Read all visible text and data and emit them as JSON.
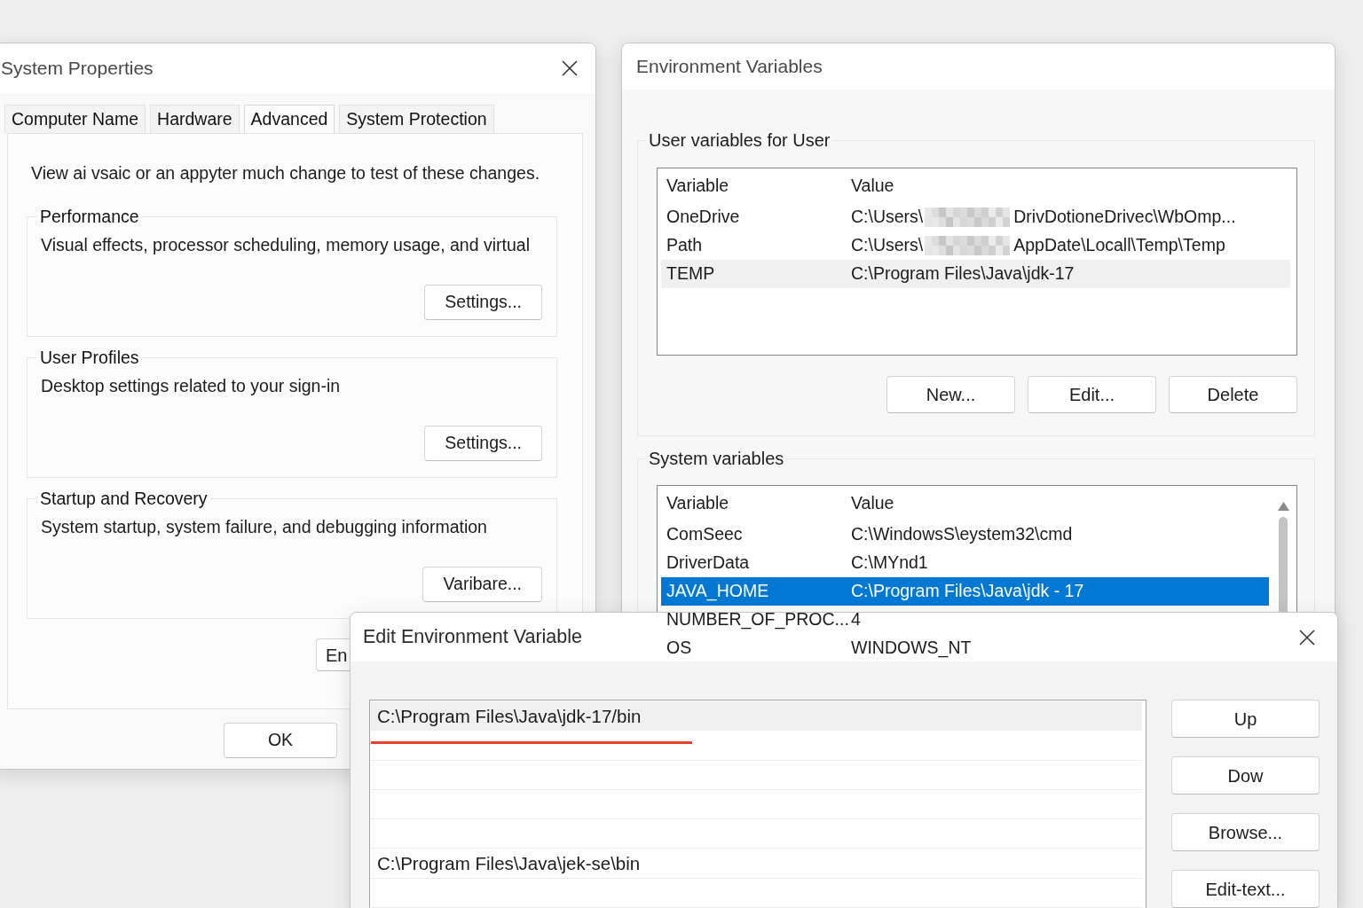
{
  "system_properties": {
    "title": "System Properties",
    "close_button": true,
    "tabs": [
      {
        "label": "Computer Name",
        "selected": false
      },
      {
        "label": "Hardware",
        "selected": false
      },
      {
        "label": "Advanced",
        "selected": true
      },
      {
        "label": "System Protection",
        "selected": false
      }
    ],
    "intro": "View ai vsaic or an appyter much change to test of these changes.",
    "groups": [
      {
        "title": "Performance",
        "description": "Visual effects, processor scheduling, memory usage, and virtual",
        "button": "Settings..."
      },
      {
        "title": "User Profiles",
        "description": "Desktop settings related to your sign-in",
        "button": "Settings..."
      },
      {
        "title": "Startup and Recovery",
        "description": "System startup, system failure, and debugging information",
        "button": "Varibare..."
      }
    ],
    "partial_button": "En",
    "footer_buttons": [
      "OK"
    ]
  },
  "environment_variables": {
    "title": "Environment Variables",
    "user_variables": {
      "title": "User variables for User",
      "focused": false,
      "scrollable": false,
      "columns": [
        "Variable",
        "Value"
      ],
      "rows": [
        {
          "variable": "OneDrive",
          "value": [
            {
              "kind": "text",
              "text": "C:\\Users\\"
            },
            {
              "kind": "redacted"
            },
            {
              "kind": "text",
              "text": "DrivDotioneDrivec\\WbOmp..."
            }
          ],
          "selected": false
        },
        {
          "variable": "Path",
          "value": [
            {
              "kind": "text",
              "text": "C:\\Users\\"
            },
            {
              "kind": "redacted"
            },
            {
              "kind": "text",
              "text": "AppDate\\Locall\\Temp\\Temp"
            }
          ],
          "selected": false
        },
        {
          "variable": "TEMP",
          "value": "C:\\Program Files\\Java\\jdk-17",
          "selected": true
        }
      ],
      "buttons": [
        "New...",
        "Edit...",
        "Delete"
      ]
    },
    "system_variables": {
      "title": "System variables",
      "focused": true,
      "scrollable": true,
      "columns": [
        "Variable",
        "Value"
      ],
      "rows": [
        {
          "variable": "ComSeec",
          "value": "C:\\WindowsS\\eystem32\\cmd",
          "selected": false
        },
        {
          "variable": "DriverData",
          "value": "C:\\MYnd1",
          "selected": false
        },
        {
          "variable": "JAVA_HOME",
          "value": "C:\\Program Files\\Java\\jdk - 17",
          "selected": true
        },
        {
          "variable": "NUMBER_OF_PROC...",
          "value": "4",
          "selected": false
        },
        {
          "variable": "OS",
          "value": "WINDOWS_NT",
          "selected": false
        }
      ]
    }
  },
  "edit_dialog": {
    "title": "Edit Environment Variable",
    "close_button": true,
    "entries": [
      {
        "kind": "path",
        "text": "C:\\Program Files\\Java\\jdk-17/bin",
        "selected": true,
        "underlined": true
      },
      {
        "kind": "blank",
        "selected": false,
        "underlined": false
      },
      {
        "kind": "blank",
        "selected": false,
        "underlined": false
      },
      {
        "kind": "blank",
        "selected": false,
        "underlined": false
      },
      {
        "kind": "path",
        "text": "C:\\Program Files\\Java\\jek-se\\bin",
        "selected": false,
        "underlined": false
      },
      {
        "kind": "blank",
        "selected": false,
        "underlined": false
      }
    ],
    "buttons": [
      "Up",
      "Dow",
      "Browse...",
      "Edit-text..."
    ]
  }
}
